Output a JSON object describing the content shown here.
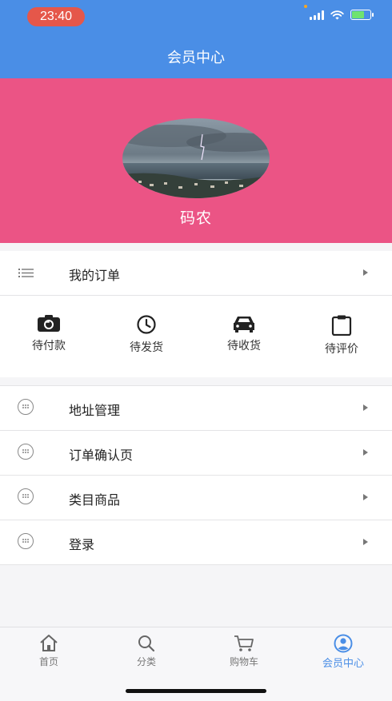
{
  "status_bar": {
    "time": "23:40",
    "accent": "#e5574a"
  },
  "header": {
    "title": "会员中心",
    "bg_color": "#4a8ee6"
  },
  "profile": {
    "username": "码农",
    "bg_color": "#eb5485",
    "avatar_icon": "avatar-photo"
  },
  "orders": {
    "label": "我的订单",
    "icon": "list-icon"
  },
  "order_status": [
    {
      "label": "待付款",
      "icon": "camera-icon"
    },
    {
      "label": "待发货",
      "icon": "clock-icon"
    },
    {
      "label": "待收货",
      "icon": "car-icon"
    },
    {
      "label": "待评价",
      "icon": "clipboard-icon"
    }
  ],
  "menu": [
    {
      "label": "地址管理",
      "icon": "dots-circle-icon"
    },
    {
      "label": "订单确认页",
      "icon": "dots-circle-icon"
    },
    {
      "label": "类目商品",
      "icon": "dots-circle-icon"
    },
    {
      "label": "登录",
      "icon": "dots-circle-icon"
    }
  ],
  "tabbar": {
    "active_color": "#4a8ee6",
    "items": [
      {
        "label": "首页",
        "icon": "home-icon"
      },
      {
        "label": "分类",
        "icon": "search-icon"
      },
      {
        "label": "购物车",
        "icon": "cart-icon"
      },
      {
        "label": "会员中心",
        "icon": "user-icon",
        "active": true
      }
    ]
  }
}
